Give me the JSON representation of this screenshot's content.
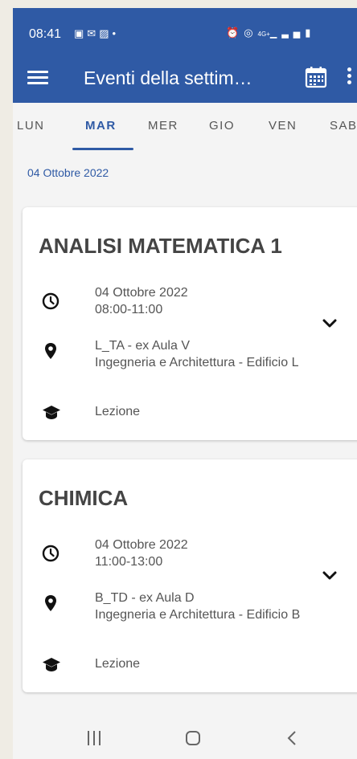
{
  "status": {
    "time": "08:41",
    "left_icons": [
      "notification-icon",
      "mail-icon",
      "gallery-icon",
      "dot-icon"
    ],
    "right_icons": [
      "alarm-icon",
      "hotspot-icon",
      "signal-4g-icon",
      "battery-icon"
    ],
    "network_label": "4G+"
  },
  "appbar": {
    "title": "Eventi della settim…",
    "background": "#2f5aa5"
  },
  "tabs": [
    {
      "label": "LUN"
    },
    {
      "label": "MAR",
      "active": true
    },
    {
      "label": "MER"
    },
    {
      "label": "GIO"
    },
    {
      "label": "VEN"
    },
    {
      "label": "SAB"
    }
  ],
  "date_header": "04 Ottobre 2022",
  "events": [
    {
      "title": "ANALISI MATEMATICA 1",
      "date": "04 Ottobre 2022",
      "time": "08:00-11:00",
      "room": "L_TA - ex Aula V",
      "building": "Ingegneria e Architettura - Edificio L",
      "type": "Lezione"
    },
    {
      "title": "CHIMICA",
      "date": "04 Ottobre 2022",
      "time": "11:00-13:00",
      "room": "B_TD - ex Aula D",
      "building": "Ingegneria e Architettura - Edificio B",
      "type": "Lezione"
    }
  ]
}
